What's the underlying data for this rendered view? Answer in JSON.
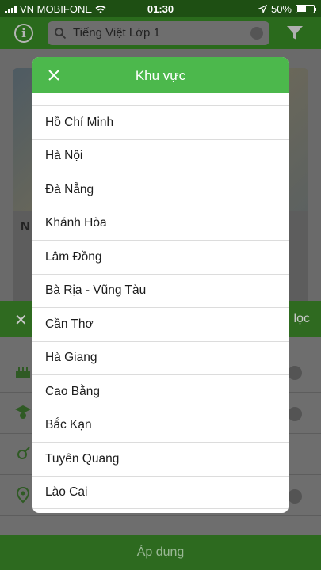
{
  "status_bar": {
    "carrier": "VN MOBIFONE",
    "time": "01:30",
    "battery": "50%",
    "battery_level": 0.5
  },
  "header": {
    "search_value": "Tiếng Việt Lớp 1",
    "icons": [
      "info-icon",
      "search-icon",
      "clear-icon",
      "filter-icon"
    ]
  },
  "background": {
    "card_text": "N",
    "filter_sheet_title": "lọc",
    "apply_label": "Áp dụng"
  },
  "modal": {
    "title": "Khu vực",
    "items": [
      "Hồ Chí Minh",
      "Hà Nội",
      "Đà Nẵng",
      "Khánh Hòa",
      "Lâm Đồng",
      "Bà Rịa - Vũng Tàu",
      "Cần Thơ",
      "Hà Giang",
      "Cao Bằng",
      "Bắc Kạn",
      "Tuyên Quang",
      "Lào Cai"
    ]
  },
  "colors": {
    "accent_green": "#4cb84c",
    "status_bar": "#1e4f13"
  }
}
